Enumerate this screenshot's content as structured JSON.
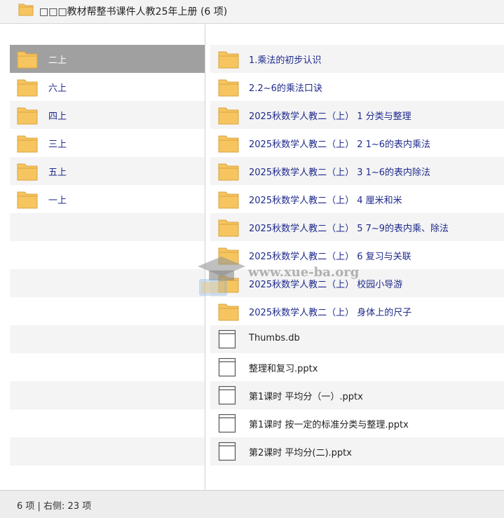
{
  "title": "□□□教材帮整书课件人教25年上册 (6 项)",
  "left_pane": {
    "items": [
      {
        "label": "二上",
        "selected": true
      },
      {
        "label": "六上",
        "selected": false
      },
      {
        "label": "四上",
        "selected": false
      },
      {
        "label": "三上",
        "selected": false
      },
      {
        "label": "五上",
        "selected": false
      },
      {
        "label": "一上",
        "selected": false
      }
    ]
  },
  "right_pane": {
    "items": [
      {
        "label": "1.乘法的初步认识",
        "kind": "folder"
      },
      {
        "label": "2.2~6的乘法口诀",
        "kind": "folder"
      },
      {
        "label": "2025秋数学人教二（上） 1  分类与整理",
        "kind": "folder"
      },
      {
        "label": "2025秋数学人教二（上） 2  1~6的表内乘法",
        "kind": "folder"
      },
      {
        "label": "2025秋数学人教二（上） 3  1~6的表内除法",
        "kind": "folder"
      },
      {
        "label": "2025秋数学人教二（上） 4  厘米和米",
        "kind": "folder"
      },
      {
        "label": "2025秋数学人教二（上） 5  7~9的表内乘、除法",
        "kind": "folder"
      },
      {
        "label": "2025秋数学人教二（上） 6  复习与关联",
        "kind": "folder"
      },
      {
        "label": "2025秋数学人教二（上） 校园小导游",
        "kind": "folder"
      },
      {
        "label": "2025秋数学人教二（上） 身体上的尺子",
        "kind": "folder"
      },
      {
        "label": "Thumbs.db",
        "kind": "file"
      },
      {
        "label": "整理和复习.pptx",
        "kind": "file"
      },
      {
        "label": "第1课时  平均分（一）.pptx",
        "kind": "file"
      },
      {
        "label": "第1课时  按一定的标准分类与整理.pptx",
        "kind": "file"
      },
      {
        "label": "第2课时  平均分(二).pptx",
        "kind": "file"
      }
    ]
  },
  "status": "6 项 | 右侧: 23 项",
  "watermark": "www.xue-ba.org",
  "colors": {
    "folder": "#f6c55f",
    "folder_edge": "#d9a23d",
    "selected_row": "#a0a0a0",
    "link_text": "#1f2a8c"
  }
}
